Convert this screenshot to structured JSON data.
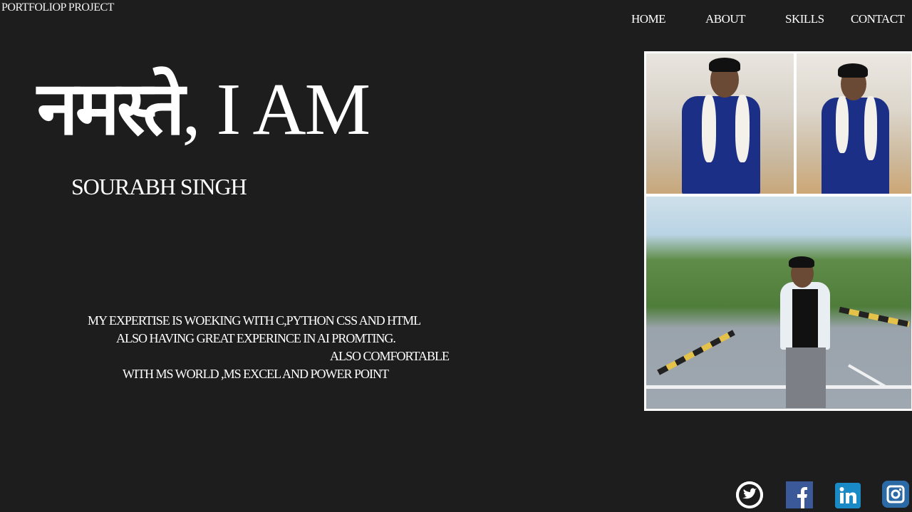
{
  "brand": "PORTFOLIOP PROJECT",
  "nav": {
    "home": "HOME",
    "about": "ABOUT",
    "skills": "SKILLS",
    "contact": "CONTACT"
  },
  "hero": {
    "greeting": "नमस्ते",
    "suffix": ", I AM",
    "name": "SOURABH  SINGH"
  },
  "bio": {
    "line1": "MY EXPERTISE  IS WOEKING WITH C,PYTHON CSS AND HTML",
    "line2": "ALSO HAVING GREAT EXPERINCE IN AI PROMTING.",
    "line3": "ALSO COMFORTABLE",
    "line4": "WITH MS WORLD ,MS EXCEL AND POWER POINT"
  },
  "social": [
    {
      "name": "twitter",
      "icon": "twitter-icon"
    },
    {
      "name": "facebook",
      "icon": "facebook-icon"
    },
    {
      "name": "linkedin",
      "icon": "linkedin-icon"
    },
    {
      "name": "instagram",
      "icon": "instagram-icon"
    }
  ],
  "colors": {
    "background": "#1e1d1d",
    "text": "#ffffff",
    "facebook": "#3b5998",
    "linkedin": "#1a8ac6",
    "instagram": "#2c6aa6"
  }
}
